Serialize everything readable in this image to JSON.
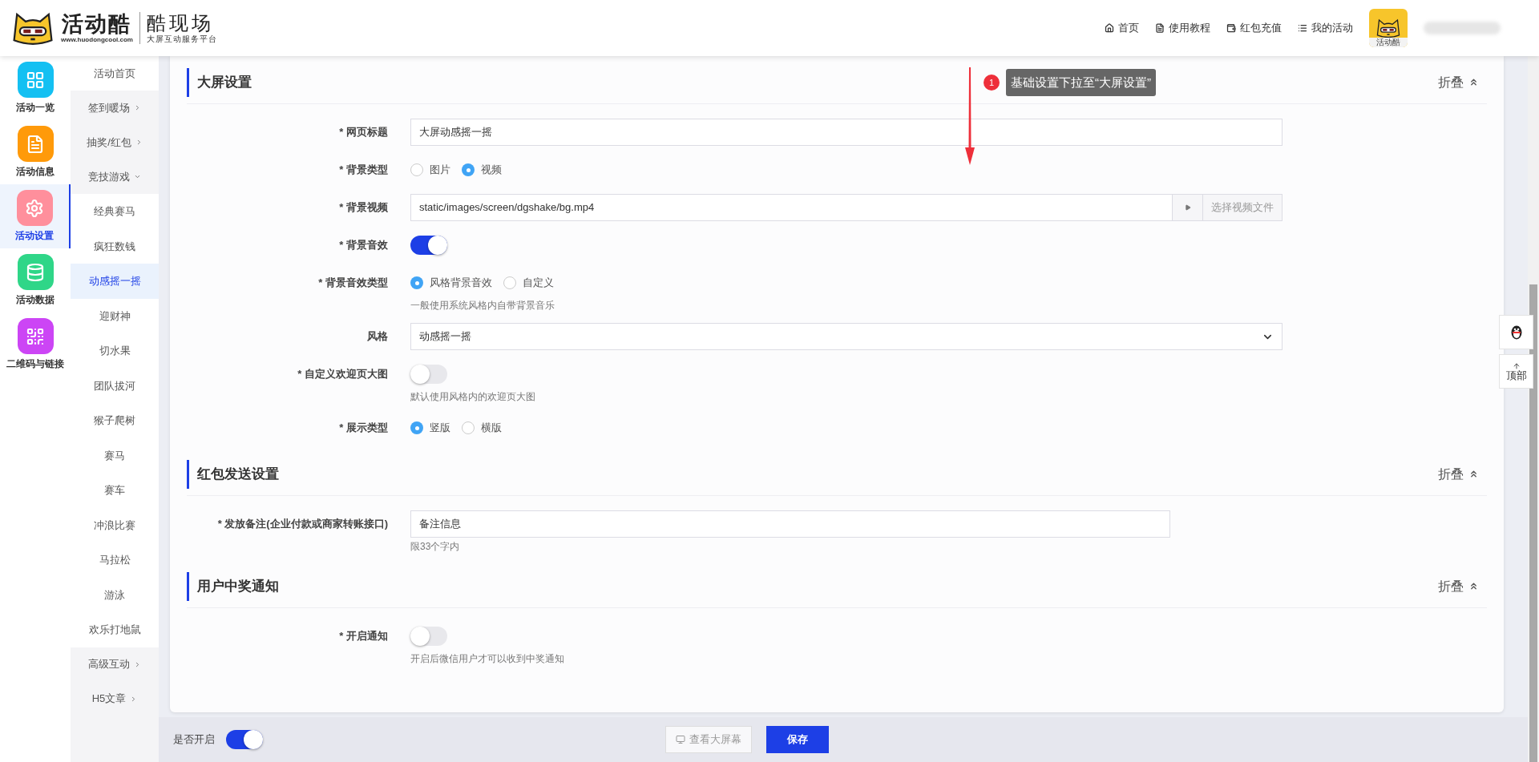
{
  "header": {
    "logo": {
      "brand": "活动酷",
      "url": "www.huodongcool.com",
      "product": "酷现场",
      "tagline": "大屏互动服务平台"
    },
    "nav": [
      {
        "label": "首页",
        "kind": "home"
      },
      {
        "label": "使用教程",
        "kind": "doc"
      },
      {
        "label": "红包充值",
        "kind": "wallet"
      },
      {
        "label": "我的活动",
        "kind": "list"
      }
    ],
    "avatar": {
      "caption": "活动酷"
    }
  },
  "icon_rail": [
    {
      "label": "活动一览",
      "kind": "grid",
      "color": "#14c0f2",
      "selected": false
    },
    {
      "label": "活动信息",
      "kind": "doc",
      "color": "#ff9a0a",
      "selected": false
    },
    {
      "label": "活动设置",
      "kind": "gear",
      "color": "#ff8f9c",
      "selected": true
    },
    {
      "label": "活动数据",
      "kind": "database",
      "color": "#2fd688",
      "selected": false
    },
    {
      "label": "二维码与链接",
      "kind": "qr",
      "color": "#cc45f5",
      "selected": false
    }
  ],
  "submenu": [
    {
      "label": "活动首页",
      "kind": "link",
      "selected": false
    },
    {
      "label": "签到暖场",
      "kind": "group",
      "expanded": false
    },
    {
      "label": "抽奖/红包",
      "kind": "group",
      "expanded": false
    },
    {
      "label": "竞技游戏",
      "kind": "group",
      "expanded": true,
      "children": [
        {
          "label": "经典赛马",
          "selected": false
        },
        {
          "label": "疯狂数钱",
          "selected": false
        },
        {
          "label": "动感摇一摇",
          "selected": true
        },
        {
          "label": "迎财神",
          "selected": false
        },
        {
          "label": "切水果",
          "selected": false
        },
        {
          "label": "团队拔河",
          "selected": false
        },
        {
          "label": "猴子爬树",
          "selected": false
        },
        {
          "label": "赛马",
          "selected": false
        },
        {
          "label": "赛车",
          "selected": false
        },
        {
          "label": "冲浪比赛",
          "selected": false
        },
        {
          "label": "马拉松",
          "selected": false
        },
        {
          "label": "游泳",
          "selected": false
        },
        {
          "label": "欢乐打地鼠",
          "selected": false
        }
      ]
    },
    {
      "label": "高级互动",
      "kind": "group",
      "expanded": false
    },
    {
      "label": "H5文章",
      "kind": "group",
      "expanded": false
    }
  ],
  "annotation": {
    "number": "1",
    "text": "基础设置下拉至“大屏设置”"
  },
  "sections": [
    {
      "title": "大屏设置",
      "collapse_label": "折叠",
      "fields": [
        {
          "kind": "text",
          "label": "* 网页标题",
          "value": "大屏动感摇一摇"
        },
        {
          "kind": "radio",
          "label": "* 背景类型",
          "options": [
            {
              "label": "图片",
              "selected": false
            },
            {
              "label": "视频",
              "selected": true
            }
          ]
        },
        {
          "kind": "file",
          "label": "* 背景视频",
          "value": "static/images/screen/dgshake/bg.mp4",
          "button": "选择视频文件"
        },
        {
          "kind": "switch",
          "label": "* 背景音效",
          "on": true
        },
        {
          "kind": "radio",
          "label": "* 背景音效类型",
          "options": [
            {
              "label": "风格背景音效",
              "selected": true
            },
            {
              "label": "自定义",
              "selected": false
            }
          ],
          "hint": "一般使用系统风格内自带背景音乐"
        },
        {
          "kind": "select",
          "label": "风格",
          "value": "动感摇一摇"
        },
        {
          "kind": "switch",
          "label": "* 自定义欢迎页大图",
          "on": false,
          "hint": "默认使用风格内的欢迎页大图"
        },
        {
          "kind": "radio",
          "label": "* 展示类型",
          "options": [
            {
              "label": "竖版",
              "selected": true
            },
            {
              "label": "横版",
              "selected": false
            }
          ]
        }
      ]
    },
    {
      "title": "红包发送设置",
      "collapse_label": "折叠",
      "fields": [
        {
          "kind": "short_text",
          "label": "* 发放备注(企业付款或商家转账接口)",
          "value": "备注信息",
          "hint": "限33个字内"
        }
      ]
    },
    {
      "title": "用户中奖通知",
      "collapse_label": "折叠",
      "fields": [
        {
          "kind": "switch",
          "label": "* 开启通知",
          "on": false,
          "hint": "开启后微信用户才可以收到中奖通知"
        }
      ]
    }
  ],
  "float_buttons": {
    "top_label": "顶部"
  },
  "footer": {
    "enable_label": "是否开启",
    "enabled": true,
    "preview_button": "查看大屏幕",
    "save_button": "保存"
  }
}
